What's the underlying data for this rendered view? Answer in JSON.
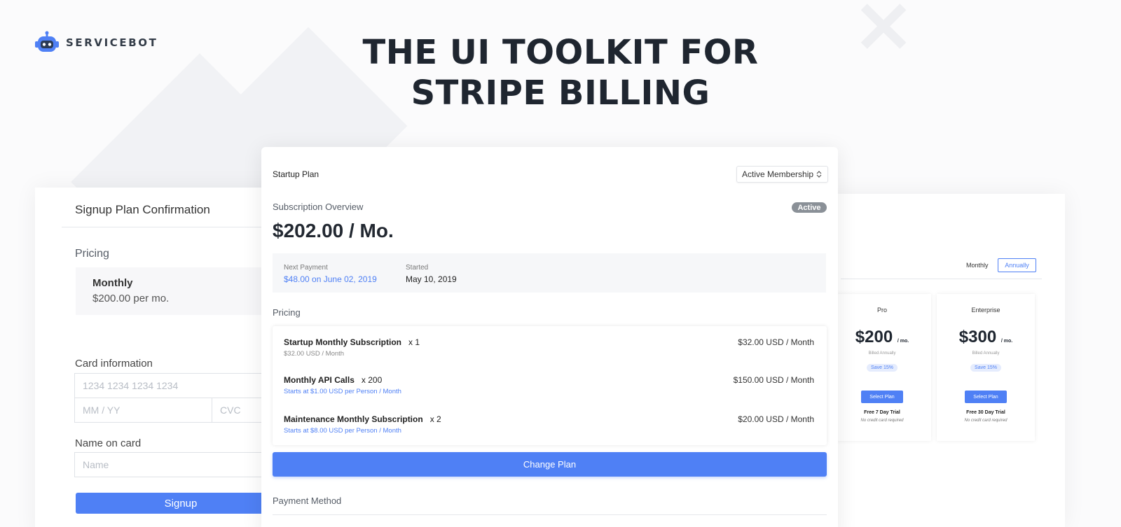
{
  "brand": {
    "name": "SERVICEBOT",
    "accent": "#4f80f5"
  },
  "headline": {
    "line1": "THE UI TOOLKIT FOR",
    "line2": "STRIPE BILLING"
  },
  "signup_card": {
    "title": "Signup Plan Confirmation",
    "pricing_label": "Pricing",
    "plan_name": "Monthly",
    "plan_price": "$200.00 per mo.",
    "card_info_label": "Card information",
    "card_number_placeholder": "1234 1234 1234 1234",
    "expiry_placeholder": "MM / YY",
    "cvc_placeholder": "CVC",
    "name_label": "Name on card",
    "name_placeholder": "Name",
    "signup_button": "Signup"
  },
  "subscription_card": {
    "plan_title": "Startup Plan",
    "membership_select": "Active Membership",
    "overview_label": "Subscription Overview",
    "status_badge": "Active",
    "amount": "$202.00 / Mo.",
    "next_payment_label": "Next Payment",
    "next_payment_value": "$48.00 on June 02, 2019",
    "started_label": "Started",
    "started_value": "May 10, 2019",
    "pricing_label": "Pricing",
    "items": [
      {
        "name": "Startup Monthly Subscription",
        "qty": "x 1",
        "sub": "$32.00 USD / Month",
        "price": "$32.00 USD / Month"
      },
      {
        "name": "Monthly API Calls",
        "qty": "x 200",
        "sub": "Starts at $1.00 USD per Person / Month",
        "price": "$150.00 USD / Month"
      },
      {
        "name": "Maintenance Monthly Subscription",
        "qty": "x 2",
        "sub": "Starts at $8.00 USD per Person / Month",
        "price": "$20.00 USD / Month"
      }
    ],
    "change_plan_button": "Change Plan",
    "payment_method_label": "Payment Method"
  },
  "pricing_table": {
    "toggle_monthly": "Monthly",
    "toggle_annually": "Annually",
    "plans": [
      {
        "name": "Pro",
        "price": "$200",
        "per": "/ mo.",
        "billed": "Billed Annually",
        "save": "Save 15%",
        "button": "Select Plan",
        "trial": "Free 7 Day Trial",
        "note": "No credit card required"
      },
      {
        "name": "Enterprise",
        "price": "$300",
        "per": "/ mo.",
        "billed": "Billed Annually",
        "save": "Save 15%",
        "button": "Select Plan",
        "trial": "Free 30 Day Trial",
        "note": "No credit card required"
      }
    ]
  }
}
